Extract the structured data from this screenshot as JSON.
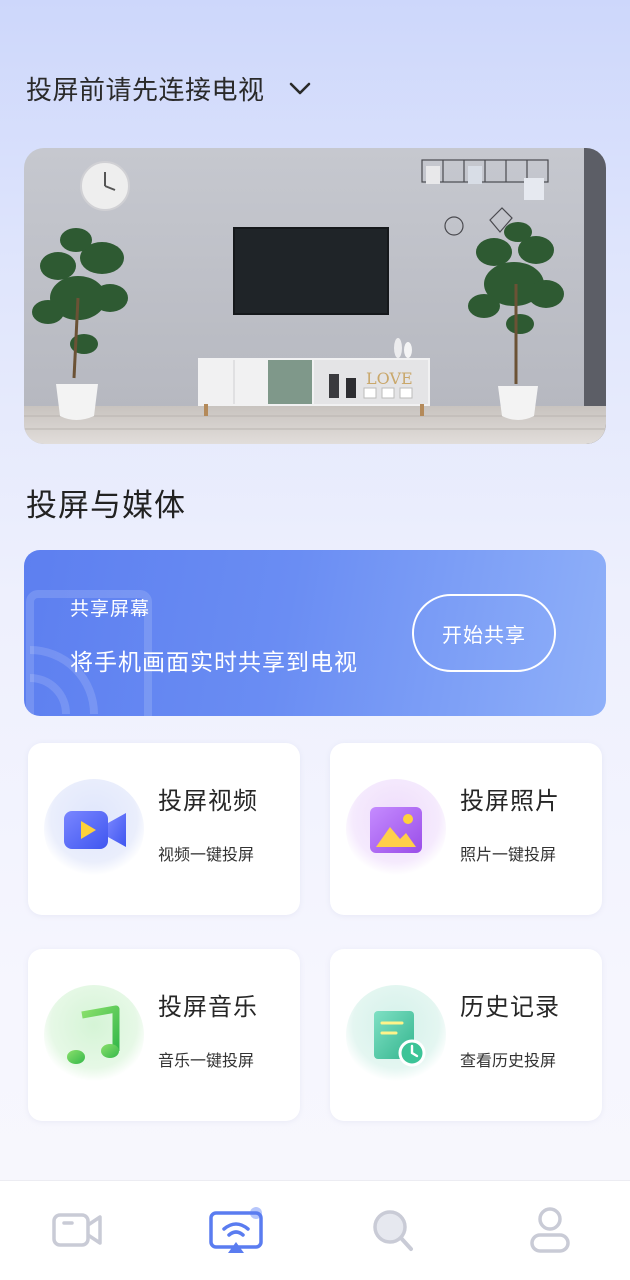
{
  "header": {
    "title": "投屏前请先连接电视"
  },
  "section_title": "投屏与媒体",
  "share": {
    "label": "共享屏幕",
    "description": "将手机画面实时共享到电视",
    "button": "开始共享"
  },
  "features": [
    {
      "title": "投屏视频",
      "subtitle": "视频一键投屏",
      "icon": "video-camera-icon"
    },
    {
      "title": "投屏照片",
      "subtitle": "照片一键投屏",
      "icon": "photo-icon"
    },
    {
      "title": "投屏音乐",
      "subtitle": "音乐一键投屏",
      "icon": "music-note-icon"
    },
    {
      "title": "历史记录",
      "subtitle": "查看历史投屏",
      "icon": "history-icon"
    }
  ],
  "bottom_nav": [
    {
      "name": "video",
      "icon": "video-icon",
      "active": false
    },
    {
      "name": "cast",
      "icon": "wifi-cast-icon",
      "active": true
    },
    {
      "name": "search",
      "icon": "search-icon",
      "active": false
    },
    {
      "name": "profile",
      "icon": "user-icon",
      "active": false
    }
  ],
  "colors": {
    "accent": "#5a7cf0",
    "nav_inactive": "#c9cbd6"
  }
}
